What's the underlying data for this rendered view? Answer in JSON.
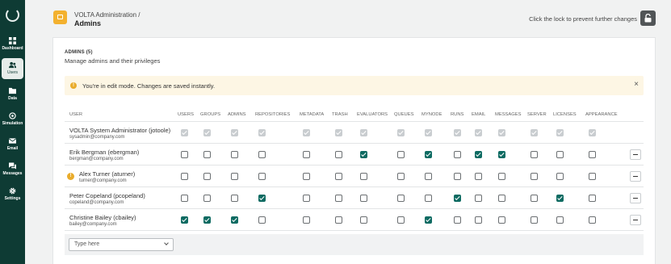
{
  "nav": {
    "items": [
      {
        "label": "Dashboard",
        "icon": "dashboard-icon"
      },
      {
        "label": "Users",
        "icon": "users-icon",
        "active": true
      },
      {
        "label": "Data",
        "icon": "folder-icon"
      },
      {
        "label": "Simulation",
        "icon": "simulation-icon"
      },
      {
        "label": "Email",
        "icon": "mail-icon"
      },
      {
        "label": "Messages",
        "icon": "messages-icon"
      },
      {
        "label": "Settings",
        "icon": "gear-icon"
      }
    ]
  },
  "header": {
    "breadcrumb": "VOLTA Administration /",
    "title": "Admins",
    "lock_hint": "Click the lock to prevent further changes"
  },
  "section": {
    "title": "ADMINS (5)",
    "subtitle": "Manage admins and their privileges"
  },
  "alert": {
    "message": "You're in edit mode. Changes are saved instantly.",
    "close": "×"
  },
  "table": {
    "user_header": "USER",
    "columns": [
      "USERS",
      "GROUPS",
      "ADMINS",
      "REPOSITORIES",
      "METADATA",
      "TRASH",
      "EVALUATORS",
      "QUEUES",
      "MYNODE",
      "RUNS",
      "EMAIL",
      "MESSAGES",
      "SERVER",
      "LICENSES",
      "APPEARANCE"
    ],
    "rows": [
      {
        "name": "VOLTA System Administrator (jotoole)",
        "email": "sysadmin@company.com",
        "system": true,
        "warning": false,
        "removable": false,
        "perms": [
          1,
          1,
          1,
          1,
          1,
          1,
          1,
          1,
          1,
          1,
          1,
          1,
          1,
          1,
          1
        ]
      },
      {
        "name": "Erik Bergman (ebergman)",
        "email": "bergman@company.com",
        "system": false,
        "warning": false,
        "removable": true,
        "perms": [
          0,
          0,
          0,
          0,
          0,
          0,
          1,
          0,
          1,
          0,
          1,
          1,
          0,
          0,
          0
        ]
      },
      {
        "name": "Alex Turner (aturner)",
        "email": "turner@company.com",
        "system": false,
        "warning": true,
        "removable": true,
        "perms": [
          0,
          0,
          0,
          0,
          0,
          0,
          0,
          0,
          0,
          0,
          0,
          0,
          0,
          0,
          0
        ]
      },
      {
        "name": "Peter Copeland (pcopeland)",
        "email": "copeland@company.com",
        "system": false,
        "warning": false,
        "removable": true,
        "perms": [
          0,
          0,
          0,
          1,
          0,
          0,
          0,
          0,
          0,
          1,
          0,
          0,
          0,
          1,
          0
        ]
      },
      {
        "name": "Christine Bailey (cbailey)",
        "email": "bailey@company.com",
        "system": false,
        "warning": false,
        "removable": true,
        "perms": [
          1,
          1,
          1,
          0,
          0,
          0,
          0,
          0,
          1,
          0,
          0,
          0,
          0,
          0,
          0
        ]
      }
    ],
    "add_user_placeholder": "Type here"
  },
  "colors": {
    "sidebar": "#0e3b34",
    "accent": "#0e6b62",
    "warning": "#e9ac2c",
    "alert_bg": "#fdf6e4"
  }
}
